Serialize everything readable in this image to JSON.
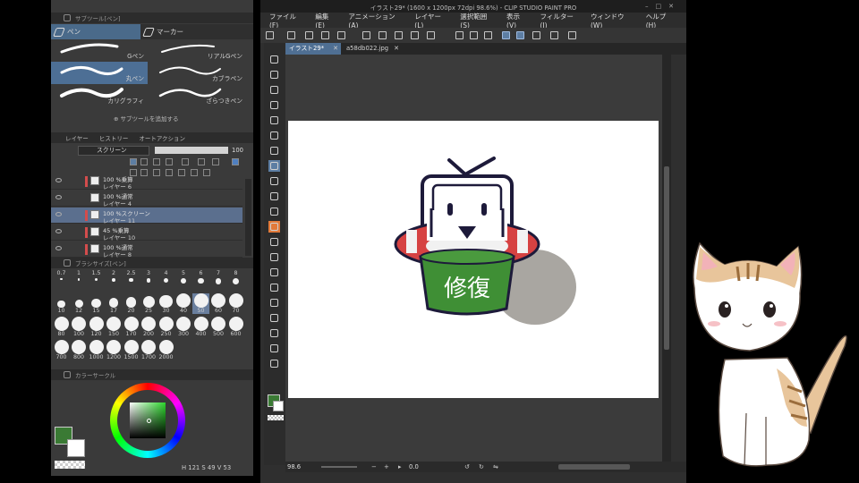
{
  "subtool_panel": {
    "title": "サブツール[ペン]",
    "tabs": [
      {
        "label": "ペン"
      },
      {
        "label": "マーカー"
      }
    ],
    "brushes": [
      {
        "label": "Gペン"
      },
      {
        "label": "リアルGペン"
      },
      {
        "label": "丸ペン"
      },
      {
        "label": "カブラペン"
      },
      {
        "label": "カリグラフィ"
      },
      {
        "label": "ざらつきペン"
      }
    ],
    "add_subtool": "サブツールを追加する"
  },
  "layer_panel": {
    "tabs": [
      "レイヤー",
      "ヒストリー",
      "オートアクション"
    ],
    "blend_mode": "スクリーン",
    "opacity": "100",
    "layers": [
      {
        "line1": "100 %乗算",
        "line2": "レイヤー 6"
      },
      {
        "line1": "100 %通常",
        "line2": "レイヤー 4"
      },
      {
        "line1": "100 %スクリーン",
        "line2": "レイヤー 11"
      },
      {
        "line1": "45 %乗算",
        "line2": "レイヤー 10"
      },
      {
        "line1": "100 %通常",
        "line2": "レイヤー 8"
      }
    ]
  },
  "brush_size_panel": {
    "title": "ブラシサイズ[ペン]",
    "sizes": [
      "0.7",
      "1",
      "1.5",
      "2",
      "2.5",
      "3",
      "4",
      "5",
      "6",
      "7",
      "8",
      "10",
      "12",
      "15",
      "17",
      "20",
      "25",
      "30",
      "40",
      "50",
      "60",
      "70",
      "80",
      "100",
      "120",
      "150",
      "170",
      "200",
      "250",
      "300",
      "400",
      "500",
      "600",
      "700",
      "800",
      "1000",
      "1200",
      "1500",
      "1700",
      "2000"
    ],
    "selected": "50"
  },
  "color_panel": {
    "title": "カラーサークル",
    "main_color": "#3a7a34",
    "info": "H 121  S 49  V 53"
  },
  "window": {
    "title": "イラスト29* (1600 x 1200px 72dpi 98.6%) - CLIP STUDIO PAINT PRO",
    "menu": [
      "ファイル(F)",
      "編集(E)",
      "アニメーション(A)",
      "レイヤー(L)",
      "選択範囲(S)",
      "表示(V)",
      "フィルター(I)",
      "ウィンドウ(W)",
      "ヘルプ(H)"
    ],
    "tabs": [
      {
        "label": "イラスト29*"
      },
      {
        "label": "a58db022.jpg"
      }
    ],
    "zoom": "98.6",
    "rotation": "0.0"
  },
  "artwork": {
    "label": "修復",
    "accent_green": "#3f8f35",
    "accent_red": "#d64242"
  }
}
